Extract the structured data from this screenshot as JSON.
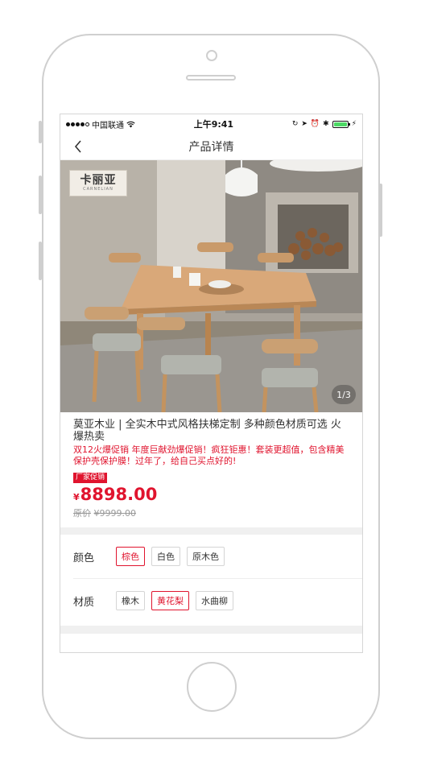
{
  "status_bar": {
    "carrier": "中国联通",
    "time": "上午9:41"
  },
  "nav": {
    "title": "产品详情"
  },
  "gallery": {
    "brand_name": "卡丽亚",
    "brand_sub": "CARNELIAN",
    "pager": "1/3"
  },
  "product": {
    "title": "莫亚木业 | 全实木中式风格扶梯定制 多种颜色材质可选 火爆热卖",
    "promo": "双12火爆促销 年度巨献劲爆促销！疯狂钜惠！套装更超值，包含精美保护壳保护膜！过年了，给自己买点好的!",
    "badge": "厂家促销",
    "currency": "¥",
    "price": "8898.00",
    "original_label": "原价",
    "original_price": "¥9999.00"
  },
  "options": [
    {
      "label": "颜色",
      "values": [
        "棕色",
        "白色",
        "原木色"
      ],
      "selected": 0
    },
    {
      "label": "材质",
      "values": [
        "橡木",
        "黄花梨",
        "水曲柳"
      ],
      "selected": 1
    }
  ],
  "colors": {
    "accent": "#e0142e",
    "battery": "#4cd964"
  }
}
